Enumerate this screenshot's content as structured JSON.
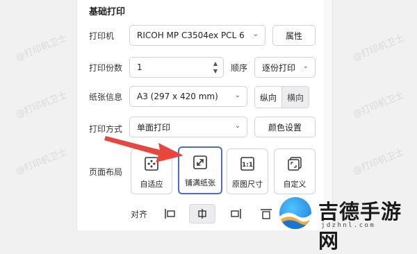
{
  "section": {
    "title": "基础打印"
  },
  "printer": {
    "label": "打印机",
    "value": "RICOH MP C3504ex PCL 6",
    "properties_label": "属性"
  },
  "copies": {
    "label": "打印份数",
    "value": "1"
  },
  "order": {
    "label": "顺序",
    "value": "逐份打印"
  },
  "paper": {
    "label": "纸张信息",
    "value": "A3 (297 x 420 mm)",
    "portrait_label": "纵向",
    "landscape_label": "横向"
  },
  "mode": {
    "label": "打印方式",
    "value": "单面打印",
    "color_settings_label": "颜色设置"
  },
  "layout": {
    "label": "页面布局",
    "options": [
      {
        "label": "自适应",
        "icon": "fit-icon",
        "selected": false
      },
      {
        "label": "铺满纸张",
        "icon": "expand-icon",
        "selected": true
      },
      {
        "label": "原图尺寸",
        "icon": "original-size-icon",
        "selected": false
      },
      {
        "label": "自定义",
        "icon": "custom-icon",
        "selected": false
      }
    ]
  },
  "alignment": {
    "label": "对齐",
    "selected": "center"
  },
  "watermark": {
    "text": "@打印机卫士"
  },
  "logo": {
    "name": "吉德手游网",
    "url": "jdzhnl.com"
  },
  "colors": {
    "accent": "#4a6ad6",
    "arrow": "#e8463c"
  }
}
